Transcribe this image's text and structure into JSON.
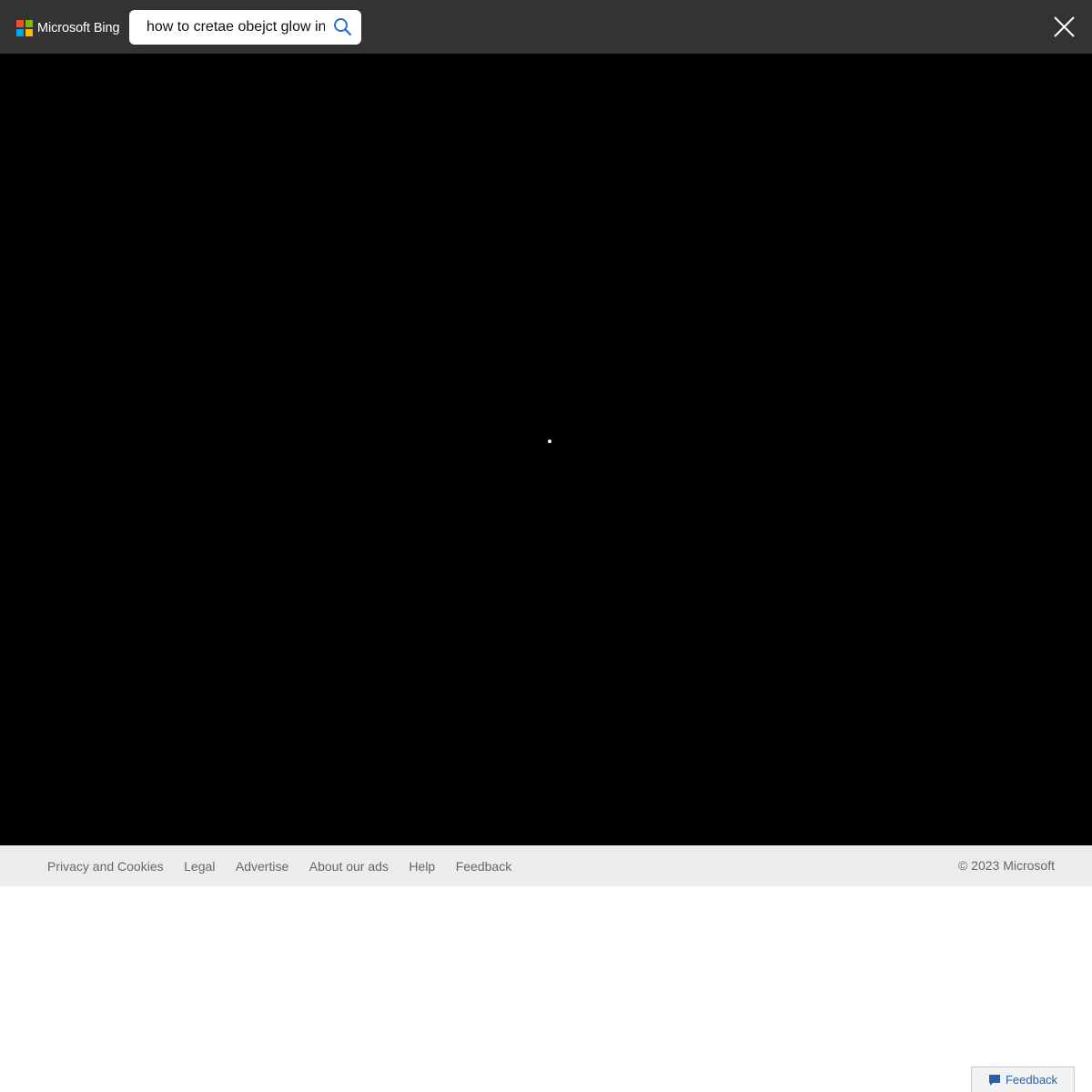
{
  "header": {
    "brand": "Microsoft Bing",
    "logo_colors": [
      "#f25022",
      "#7fba00",
      "#00a4ef",
      "#ffb900"
    ],
    "search": {
      "value": "how to cretae obejct glow in",
      "icon": "search-icon"
    },
    "close_icon": "close-icon"
  },
  "viewer": {
    "background": "#000000",
    "loading_indicator": "loading-dot"
  },
  "footer": {
    "links": [
      "Privacy and Cookies",
      "Legal",
      "Advertise",
      "About our ads",
      "Help",
      "Feedback"
    ],
    "copyright": "© 2023 Microsoft"
  },
  "feedback_button": {
    "label": "Feedback",
    "icon": "chat-bubble-icon",
    "color": "#2a5fa8"
  }
}
